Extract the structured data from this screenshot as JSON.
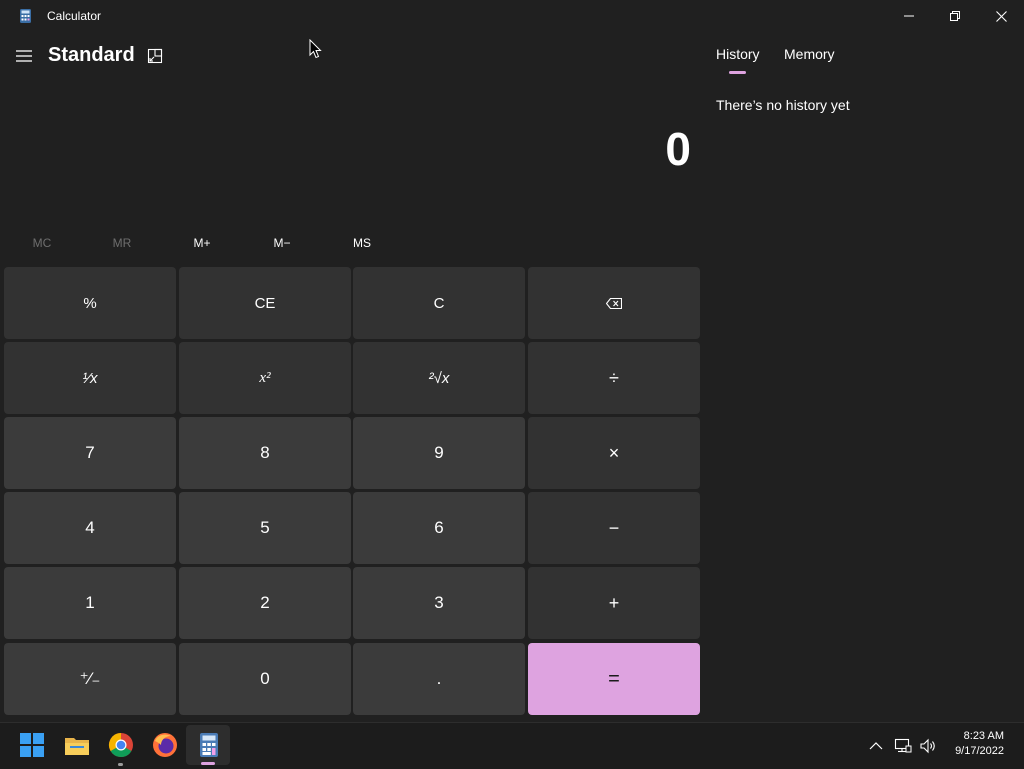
{
  "window": {
    "title": "Calculator",
    "controls": {
      "minimize": "minimize-icon",
      "restore": "restore-icon",
      "close": "close-icon"
    }
  },
  "header": {
    "mode": "Standard",
    "menu_icon": "hamburger-menu-icon",
    "keep_on_top_icon": "keep-on-top-icon"
  },
  "display": {
    "value": "0"
  },
  "memory": {
    "buttons": [
      {
        "label": "MC",
        "enabled": false
      },
      {
        "label": "MR",
        "enabled": false
      },
      {
        "label": "M+",
        "enabled": true
      },
      {
        "label": "M−",
        "enabled": true
      },
      {
        "label": "MS",
        "enabled": true
      }
    ]
  },
  "keypad": {
    "rows": [
      [
        "%",
        "CE",
        "C",
        "⌫"
      ],
      [
        "¹⁄x",
        "x²",
        "²√x",
        "÷"
      ],
      [
        "7",
        "8",
        "9",
        "×"
      ],
      [
        "4",
        "5",
        "6",
        "−"
      ],
      [
        "1",
        "2",
        "3",
        "+"
      ],
      [
        "⁺⁄₋",
        "0",
        ".",
        "="
      ]
    ]
  },
  "panel": {
    "tabs": [
      "History",
      "Memory"
    ],
    "active_tab": "History",
    "history_empty_text": "There’s no history yet"
  },
  "taskbar": {
    "apps": [
      "start-icon",
      "file-explorer-icon",
      "chrome-icon",
      "firefox-icon",
      "calculator-icon"
    ],
    "active_app": "calculator-icon",
    "clock": {
      "time": "8:23 AM",
      "date": "9/17/2022"
    }
  },
  "colors": {
    "background": "#202020",
    "key_function": "#323232",
    "key_number": "#3b3b3b",
    "accent": "#dea3e0"
  }
}
